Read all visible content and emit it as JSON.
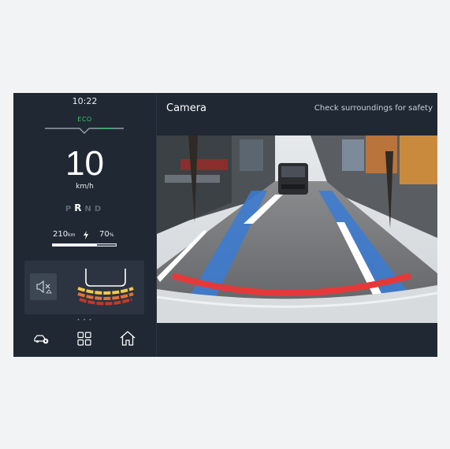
{
  "status": {
    "time": "10:22",
    "drive_mode": "ECO"
  },
  "speedometer": {
    "value": "10",
    "unit": "km/h"
  },
  "gear_selector": {
    "gears": [
      "P",
      "R",
      "N",
      "D"
    ],
    "active": "R"
  },
  "range": {
    "distance": "210",
    "distance_unit": "km",
    "battery_percent": "70",
    "battery_unit": "%",
    "battery_level": 0.7
  },
  "parking_sensors": {
    "mute_icon": "speaker-mute-icon"
  },
  "pager": {
    "dots": "• • •"
  },
  "bottom_nav": {
    "items": [
      "car-settings-icon",
      "grid-icon",
      "home-icon"
    ]
  },
  "camera": {
    "title": "Camera",
    "safety_note": "Check surroundings for safety"
  },
  "colors": {
    "background": "#1f2833",
    "card": "#2b3440",
    "eco": "#43c26a",
    "guide_red": "#e53939",
    "guide_blue": "#3a7bd5"
  }
}
